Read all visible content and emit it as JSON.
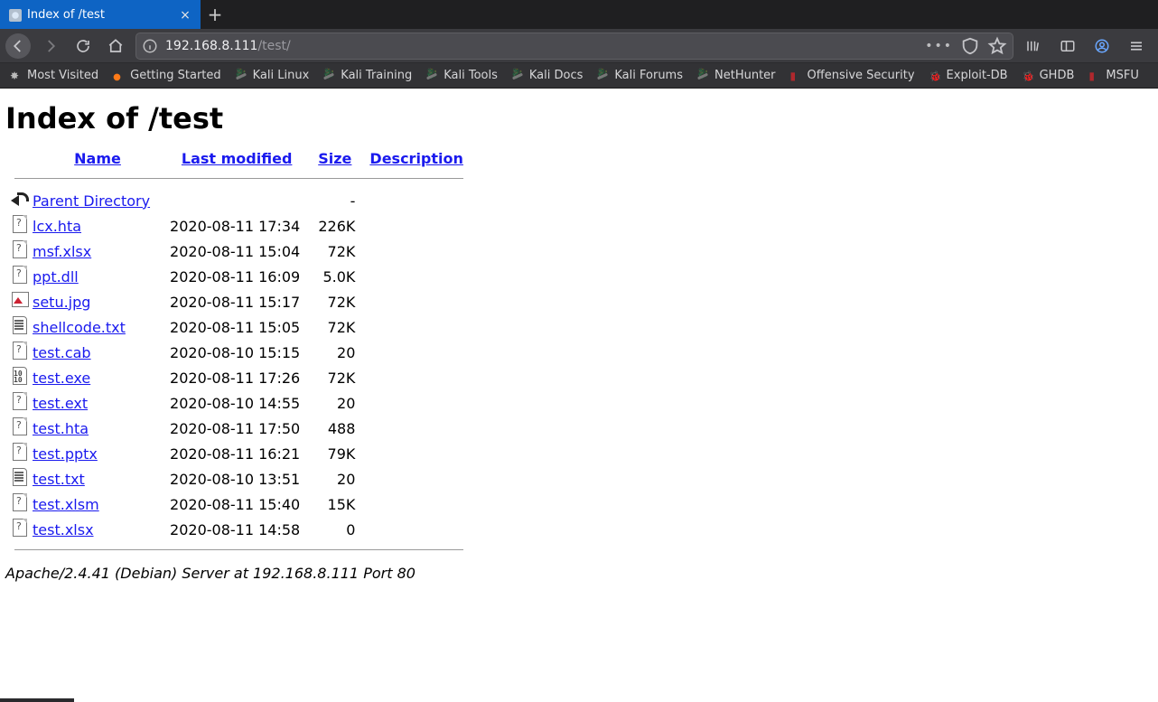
{
  "browser": {
    "tab_title": "Index of /test",
    "url": {
      "host": "192.168.8.111",
      "path": "/test/"
    },
    "bookmarks": [
      {
        "label": "Most Visited",
        "icon": "star"
      },
      {
        "label": "Getting Started",
        "icon": "fox"
      },
      {
        "label": "Kali Linux",
        "icon": "kali"
      },
      {
        "label": "Kali Training",
        "icon": "kali"
      },
      {
        "label": "Kali Tools",
        "icon": "kali"
      },
      {
        "label": "Kali Docs",
        "icon": "kali"
      },
      {
        "label": "Kali Forums",
        "icon": "kali"
      },
      {
        "label": "NetHunter",
        "icon": "kali"
      },
      {
        "label": "Offensive Security",
        "icon": "red"
      },
      {
        "label": "Exploit-DB",
        "icon": "orange"
      },
      {
        "label": "GHDB",
        "icon": "orange"
      },
      {
        "label": "MSFU",
        "icon": "red"
      }
    ]
  },
  "page": {
    "heading": "Index of /test",
    "columns": {
      "name": "Name",
      "modified": "Last modified",
      "size": "Size",
      "description": "Description"
    },
    "parent": {
      "label": "Parent Directory",
      "size": "-"
    },
    "files": [
      {
        "icon": "paper",
        "name": "lcx.hta",
        "modified": "2020-08-11 17:34",
        "size": "226K"
      },
      {
        "icon": "paper",
        "name": "msf.xlsx",
        "modified": "2020-08-11 15:04",
        "size": "72K"
      },
      {
        "icon": "paper",
        "name": "ppt.dll",
        "modified": "2020-08-11 16:09",
        "size": "5.0K"
      },
      {
        "icon": "image",
        "name": "setu.jpg",
        "modified": "2020-08-11 15:17",
        "size": "72K"
      },
      {
        "icon": "text",
        "name": "shellcode.txt",
        "modified": "2020-08-11 15:05",
        "size": "72K"
      },
      {
        "icon": "paper",
        "name": "test.cab",
        "modified": "2020-08-10 15:15",
        "size": "20"
      },
      {
        "icon": "binary",
        "name": "test.exe",
        "modified": "2020-08-11 17:26",
        "size": "72K"
      },
      {
        "icon": "paper",
        "name": "test.ext",
        "modified": "2020-08-10 14:55",
        "size": "20"
      },
      {
        "icon": "paper",
        "name": "test.hta",
        "modified": "2020-08-11 17:50",
        "size": "488"
      },
      {
        "icon": "paper",
        "name": "test.pptx",
        "modified": "2020-08-11 16:21",
        "size": "79K"
      },
      {
        "icon": "text",
        "name": "test.txt",
        "modified": "2020-08-10 13:51",
        "size": "20"
      },
      {
        "icon": "paper",
        "name": "test.xlsm",
        "modified": "2020-08-11 15:40",
        "size": "15K"
      },
      {
        "icon": "paper",
        "name": "test.xlsx",
        "modified": "2020-08-11 14:58",
        "size": "0"
      }
    ],
    "server_signature": "Apache/2.4.41 (Debian) Server at 192.168.8.111 Port 80"
  }
}
